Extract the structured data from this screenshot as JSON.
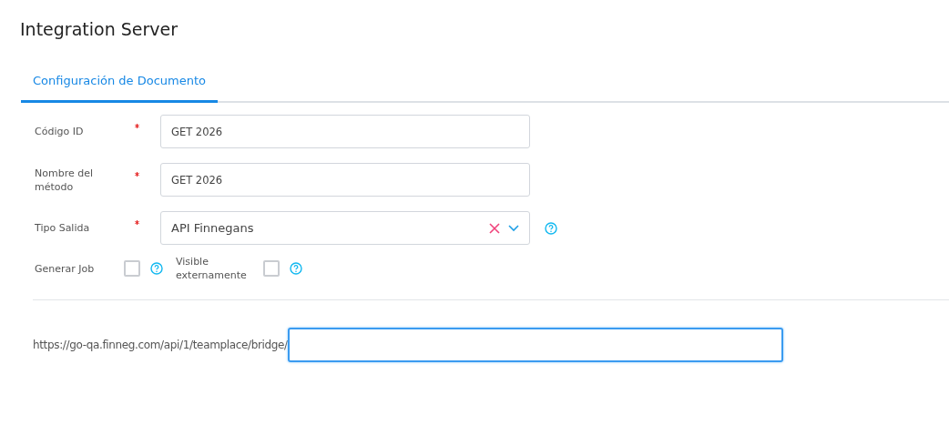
{
  "page": {
    "title": "Integration Server"
  },
  "tabs": [
    {
      "label": "Configuración de Documento",
      "selected": true
    }
  ],
  "fields": [
    {
      "kind": "text",
      "label": "Código ID",
      "required": true,
      "value": "GET 2026",
      "help": false
    },
    {
      "kind": "text",
      "label": "Nombre del método",
      "required": true,
      "value": "GET 2026",
      "help": false
    },
    {
      "kind": "select",
      "label": "Tipo Salida",
      "required": true,
      "value": "API Finnegans",
      "help": true
    }
  ],
  "checkboxes": [
    {
      "label": "Generar Job",
      "checked": false,
      "help": true
    },
    {
      "label": "Visible externamente",
      "checked": false,
      "help": true
    }
  ],
  "url": {
    "prefix": "https://go-qa.finneg.com/api/1/teamplace/bridge/",
    "focused": true
  }
}
